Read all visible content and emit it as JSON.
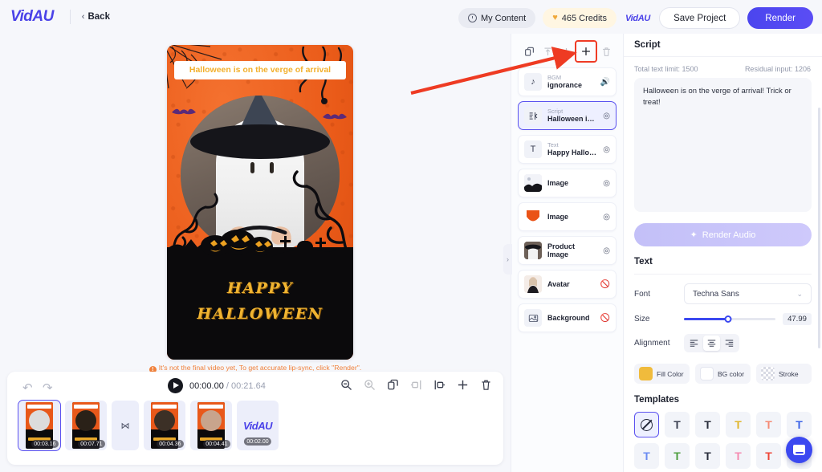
{
  "app": {
    "logo": "VidAU",
    "back_label": "Back",
    "back_chevron": "‹"
  },
  "topbar": {
    "my_content": "My Content",
    "credits": "465 Credits",
    "mini_logo": "VidAU",
    "save_project": "Save Project",
    "render": "Render",
    "accent_color": "#4b45ee",
    "credits_bg": "#fff6e2"
  },
  "canvas": {
    "title_text": "Halloween is on the verge of arrival",
    "headline_line1": "HAPPY",
    "headline_line2": "HALLOWEEN",
    "title_color": "#f2b02c",
    "background_color": "#e8581a",
    "warning": "It's not the final video yet, To get accurate lip-sync, click \"Render\".",
    "warning_icon": "!"
  },
  "timeline": {
    "undo_icon": "↶",
    "redo_icon": "↷",
    "current_time": "00:00.00",
    "separator": " / ",
    "total_time": "00:21.64",
    "tools": [
      {
        "name": "zoom-out-icon",
        "glyph": "zoom-out",
        "disabled": false
      },
      {
        "name": "zoom-in-icon",
        "glyph": "zoom-in",
        "disabled": true
      },
      {
        "name": "duplicate-icon",
        "glyph": "duplicate",
        "disabled": false
      },
      {
        "name": "split-left-icon",
        "glyph": "split-left",
        "disabled": true
      },
      {
        "name": "split-right-icon",
        "glyph": "split-right",
        "disabled": false
      },
      {
        "name": "add-clip-icon",
        "glyph": "plus",
        "disabled": false
      },
      {
        "name": "delete-clip-icon",
        "glyph": "trash",
        "disabled": false
      }
    ],
    "clips": [
      {
        "kind": "scene",
        "duration": "00:03.16",
        "selected": true
      },
      {
        "kind": "scene",
        "duration": "00:07.71",
        "selected": false
      },
      {
        "kind": "transition",
        "duration": "",
        "glyph": "⋈",
        "selected": false
      },
      {
        "kind": "scene",
        "duration": "00:04.36",
        "selected": false
      },
      {
        "kind": "scene",
        "duration": "00:04.41",
        "selected": false
      },
      {
        "kind": "logo",
        "duration": "00:02.00",
        "label": "VidAU",
        "selected": false
      }
    ]
  },
  "layers": {
    "tools": [
      {
        "name": "copy-layer-icon",
        "glyph": "copy",
        "disabled": false,
        "highlighted": false
      },
      {
        "name": "align-top-icon",
        "glyph": "align-top",
        "disabled": true,
        "highlighted": false
      },
      {
        "name": "align-bottom-icon",
        "glyph": "align-bottom",
        "disabled": true,
        "highlighted": false
      },
      {
        "name": "add-layer-icon",
        "glyph": "+",
        "disabled": false,
        "highlighted": true
      },
      {
        "name": "delete-layer-icon",
        "glyph": "trash",
        "disabled": true,
        "highlighted": false
      }
    ],
    "collapse_chevron": "›",
    "items": [
      {
        "kind": "BGM",
        "name": "ignorance",
        "icon": "music-note-icon",
        "eye": "speaker",
        "visible": true,
        "active": false
      },
      {
        "kind": "Script",
        "name": "Halloween is …",
        "icon": "script-icon",
        "eye": "eye",
        "visible": true,
        "active": true
      },
      {
        "kind": "Text",
        "name": "Happy Hallow…",
        "icon": "text-icon",
        "eye": "eye",
        "visible": true,
        "active": false
      },
      {
        "kind": "",
        "name": "Image",
        "icon": "image-thumb-graveyard",
        "eye": "eye",
        "visible": true,
        "active": false
      },
      {
        "kind": "",
        "name": "Image",
        "icon": "image-thumb-orange",
        "eye": "eye",
        "visible": true,
        "active": false
      },
      {
        "kind": "",
        "name": "Product Image",
        "icon": "image-thumb-product",
        "eye": "eye",
        "visible": true,
        "active": false
      },
      {
        "kind": "",
        "name": "Avatar",
        "icon": "image-thumb-avatar",
        "eye": "eye-off",
        "visible": false,
        "active": false
      },
      {
        "kind": "",
        "name": "Background",
        "icon": "background-icon",
        "eye": "eye-off",
        "visible": false,
        "active": false
      }
    ]
  },
  "right_panel": {
    "script": {
      "header": "Script",
      "total_text_limit": "Total text limit: 1500",
      "residual_input": "Residual input: 1206",
      "value": "Halloween is on the verge of arrival! Trick or treat!",
      "render_audio_label": "Render Audio",
      "render_audio_icon": "sparkle-icon"
    },
    "text": {
      "header": "Text",
      "font_label": "Font",
      "font_value": "Techna Sans",
      "font_caret": "⌄",
      "size_label": "Size",
      "size_value": "47.99",
      "size_percent": 48,
      "alignment_label": "Alignment",
      "alignment_selected": "center",
      "alignment_options": [
        "left",
        "center",
        "right"
      ],
      "fill_color_label": "Fill Color",
      "fill_color_value": "#f0bb3c",
      "bg_color_label": "BG color",
      "bg_color_value": "#ffffff",
      "stroke_label": "Stroke",
      "stroke_value": "transparent"
    },
    "templates": {
      "header": "Templates",
      "items": [
        {
          "name": "none",
          "glyph": "⊘",
          "color": "#24283a",
          "selected": true
        },
        {
          "name": "plain",
          "glyph": "T",
          "color": "#3c4152",
          "selected": false
        },
        {
          "name": "bold-dark",
          "glyph": "T",
          "color": "#2a2e3c",
          "selected": false
        },
        {
          "name": "yellow-outline",
          "glyph": "T",
          "color": "#e0b62c",
          "selected": false
        },
        {
          "name": "coral-thin",
          "glyph": "T",
          "color": "#f58a74",
          "selected": false
        },
        {
          "name": "blue-bold",
          "glyph": "T",
          "color": "#3b63e8",
          "selected": false
        },
        {
          "name": "blue-thin",
          "glyph": "T",
          "color": "#6a8bf2",
          "selected": false
        },
        {
          "name": "green-bold",
          "glyph": "T",
          "color": "#4e9e3e",
          "selected": false
        },
        {
          "name": "dark-bold",
          "glyph": "T",
          "color": "#2a2e3c",
          "selected": false
        },
        {
          "name": "pink-thin",
          "glyph": "T",
          "color": "#f58ab0",
          "selected": false
        },
        {
          "name": "red-bold",
          "glyph": "T",
          "color": "#ee4536",
          "selected": false
        },
        {
          "name": "red-thin",
          "glyph": "T",
          "color": "#ef6c5a",
          "selected": false
        }
      ]
    }
  },
  "annotation": {
    "arrow_color": "#ee3b23",
    "highlight_box_color": "#ef3b25"
  },
  "chat": {
    "icon": "chat-bubble-icon",
    "color": "#3b48f0"
  }
}
